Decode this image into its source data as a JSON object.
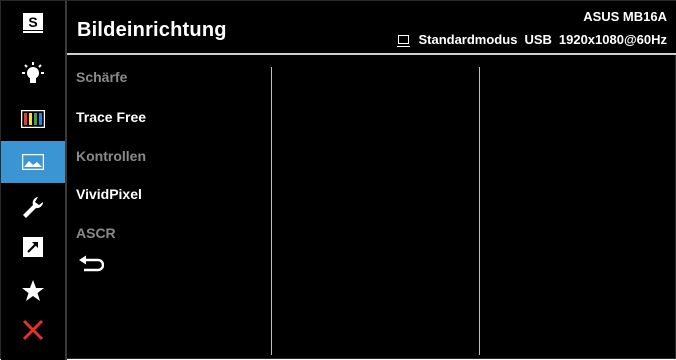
{
  "header": {
    "title": "Bildeinrichtung",
    "model": "ASUS MB16A",
    "mode": "Standardmodus",
    "input": "USB",
    "resolution": "1920x1080@60Hz"
  },
  "sidebar": {
    "items": [
      {
        "name": "splendid-icon",
        "glyph": "S"
      },
      {
        "name": "blue-light-filter-icon"
      },
      {
        "name": "color-icon"
      },
      {
        "name": "image-icon",
        "active": true
      },
      {
        "name": "system-setup-icon"
      },
      {
        "name": "shortcut-icon"
      },
      {
        "name": "favorite-icon"
      },
      {
        "name": "exit-icon"
      }
    ],
    "active_color": "#3a95d2",
    "exit_color": "#e5302b"
  },
  "menu": {
    "items": [
      {
        "label": "Schärfe",
        "state": "dim"
      },
      {
        "label": "Trace Free",
        "state": "bright"
      },
      {
        "label": "Kontrollen",
        "state": "dim"
      },
      {
        "label": "VividPixel",
        "state": "bright"
      },
      {
        "label": "ASCR",
        "state": "dim"
      }
    ]
  }
}
